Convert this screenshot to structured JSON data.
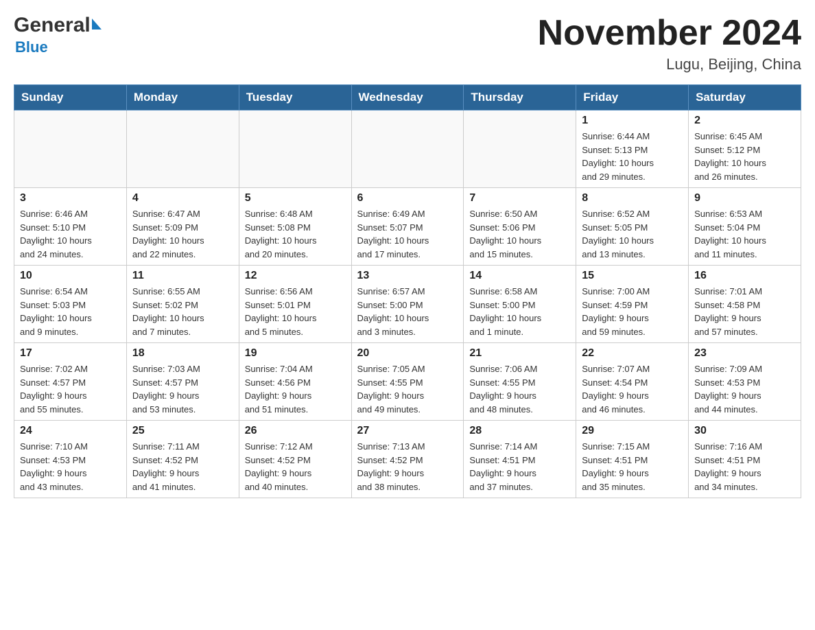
{
  "header": {
    "logo_general": "General",
    "logo_blue": "Blue",
    "main_title": "November 2024",
    "subtitle": "Lugu, Beijing, China"
  },
  "calendar": {
    "weekdays": [
      "Sunday",
      "Monday",
      "Tuesday",
      "Wednesday",
      "Thursday",
      "Friday",
      "Saturday"
    ],
    "weeks": [
      {
        "days": [
          {
            "number": "",
            "info": ""
          },
          {
            "number": "",
            "info": ""
          },
          {
            "number": "",
            "info": ""
          },
          {
            "number": "",
            "info": ""
          },
          {
            "number": "",
            "info": ""
          },
          {
            "number": "1",
            "info": "Sunrise: 6:44 AM\nSunset: 5:13 PM\nDaylight: 10 hours\nand 29 minutes."
          },
          {
            "number": "2",
            "info": "Sunrise: 6:45 AM\nSunset: 5:12 PM\nDaylight: 10 hours\nand 26 minutes."
          }
        ]
      },
      {
        "days": [
          {
            "number": "3",
            "info": "Sunrise: 6:46 AM\nSunset: 5:10 PM\nDaylight: 10 hours\nand 24 minutes."
          },
          {
            "number": "4",
            "info": "Sunrise: 6:47 AM\nSunset: 5:09 PM\nDaylight: 10 hours\nand 22 minutes."
          },
          {
            "number": "5",
            "info": "Sunrise: 6:48 AM\nSunset: 5:08 PM\nDaylight: 10 hours\nand 20 minutes."
          },
          {
            "number": "6",
            "info": "Sunrise: 6:49 AM\nSunset: 5:07 PM\nDaylight: 10 hours\nand 17 minutes."
          },
          {
            "number": "7",
            "info": "Sunrise: 6:50 AM\nSunset: 5:06 PM\nDaylight: 10 hours\nand 15 minutes."
          },
          {
            "number": "8",
            "info": "Sunrise: 6:52 AM\nSunset: 5:05 PM\nDaylight: 10 hours\nand 13 minutes."
          },
          {
            "number": "9",
            "info": "Sunrise: 6:53 AM\nSunset: 5:04 PM\nDaylight: 10 hours\nand 11 minutes."
          }
        ]
      },
      {
        "days": [
          {
            "number": "10",
            "info": "Sunrise: 6:54 AM\nSunset: 5:03 PM\nDaylight: 10 hours\nand 9 minutes."
          },
          {
            "number": "11",
            "info": "Sunrise: 6:55 AM\nSunset: 5:02 PM\nDaylight: 10 hours\nand 7 minutes."
          },
          {
            "number": "12",
            "info": "Sunrise: 6:56 AM\nSunset: 5:01 PM\nDaylight: 10 hours\nand 5 minutes."
          },
          {
            "number": "13",
            "info": "Sunrise: 6:57 AM\nSunset: 5:00 PM\nDaylight: 10 hours\nand 3 minutes."
          },
          {
            "number": "14",
            "info": "Sunrise: 6:58 AM\nSunset: 5:00 PM\nDaylight: 10 hours\nand 1 minute."
          },
          {
            "number": "15",
            "info": "Sunrise: 7:00 AM\nSunset: 4:59 PM\nDaylight: 9 hours\nand 59 minutes."
          },
          {
            "number": "16",
            "info": "Sunrise: 7:01 AM\nSunset: 4:58 PM\nDaylight: 9 hours\nand 57 minutes."
          }
        ]
      },
      {
        "days": [
          {
            "number": "17",
            "info": "Sunrise: 7:02 AM\nSunset: 4:57 PM\nDaylight: 9 hours\nand 55 minutes."
          },
          {
            "number": "18",
            "info": "Sunrise: 7:03 AM\nSunset: 4:57 PM\nDaylight: 9 hours\nand 53 minutes."
          },
          {
            "number": "19",
            "info": "Sunrise: 7:04 AM\nSunset: 4:56 PM\nDaylight: 9 hours\nand 51 minutes."
          },
          {
            "number": "20",
            "info": "Sunrise: 7:05 AM\nSunset: 4:55 PM\nDaylight: 9 hours\nand 49 minutes."
          },
          {
            "number": "21",
            "info": "Sunrise: 7:06 AM\nSunset: 4:55 PM\nDaylight: 9 hours\nand 48 minutes."
          },
          {
            "number": "22",
            "info": "Sunrise: 7:07 AM\nSunset: 4:54 PM\nDaylight: 9 hours\nand 46 minutes."
          },
          {
            "number": "23",
            "info": "Sunrise: 7:09 AM\nSunset: 4:53 PM\nDaylight: 9 hours\nand 44 minutes."
          }
        ]
      },
      {
        "days": [
          {
            "number": "24",
            "info": "Sunrise: 7:10 AM\nSunset: 4:53 PM\nDaylight: 9 hours\nand 43 minutes."
          },
          {
            "number": "25",
            "info": "Sunrise: 7:11 AM\nSunset: 4:52 PM\nDaylight: 9 hours\nand 41 minutes."
          },
          {
            "number": "26",
            "info": "Sunrise: 7:12 AM\nSunset: 4:52 PM\nDaylight: 9 hours\nand 40 minutes."
          },
          {
            "number": "27",
            "info": "Sunrise: 7:13 AM\nSunset: 4:52 PM\nDaylight: 9 hours\nand 38 minutes."
          },
          {
            "number": "28",
            "info": "Sunrise: 7:14 AM\nSunset: 4:51 PM\nDaylight: 9 hours\nand 37 minutes."
          },
          {
            "number": "29",
            "info": "Sunrise: 7:15 AM\nSunset: 4:51 PM\nDaylight: 9 hours\nand 35 minutes."
          },
          {
            "number": "30",
            "info": "Sunrise: 7:16 AM\nSunset: 4:51 PM\nDaylight: 9 hours\nand 34 minutes."
          }
        ]
      }
    ]
  }
}
